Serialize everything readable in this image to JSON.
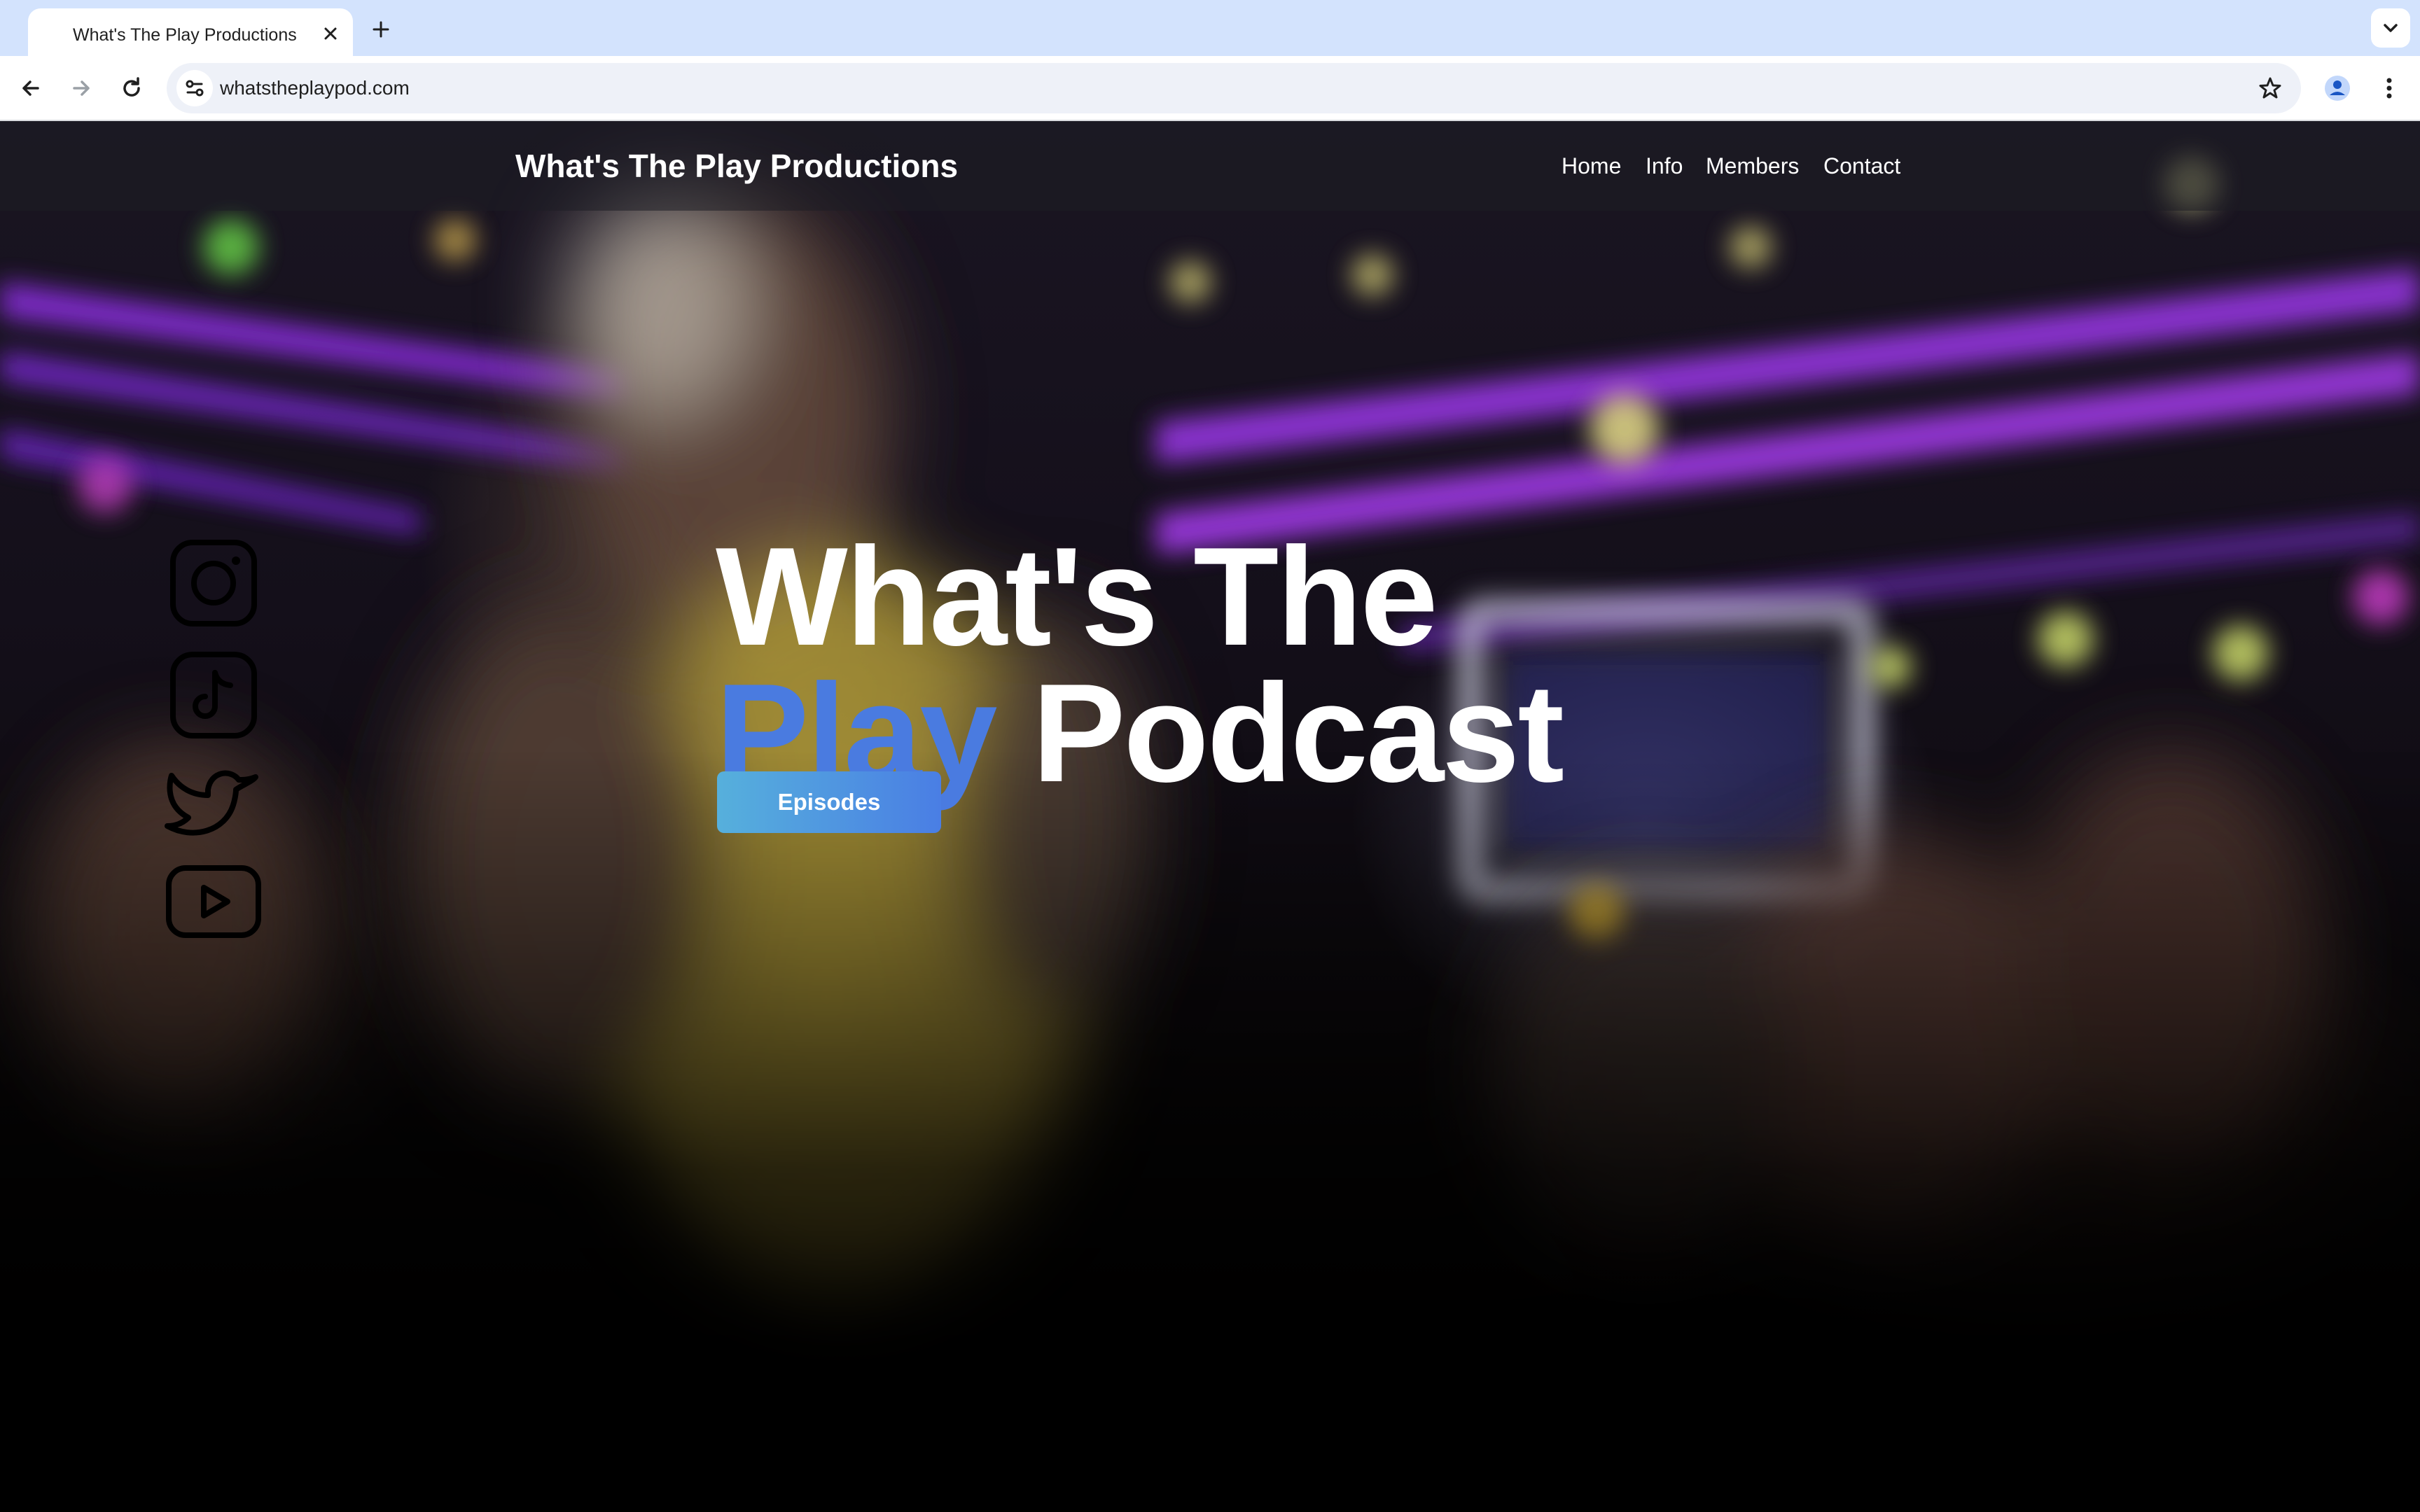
{
  "browser": {
    "tab": {
      "title": "What's The Play Productions"
    },
    "address_bar": {
      "url": "whatstheplaypod.com"
    },
    "icons": {
      "back": "arrow-left-icon",
      "forward": "arrow-right-icon",
      "reload": "reload-icon",
      "site_info": "tune-icon",
      "bookmark": "star-icon",
      "profile": "person-icon",
      "menu": "more-vertical-icon",
      "new_tab": "plus-icon",
      "close_tab": "close-icon",
      "tab_list": "chevron-down-icon"
    },
    "colors": {
      "tabstrip": "#d3e3fd",
      "toolbar": "#ffffff",
      "omnibox": "#eef1f8"
    }
  },
  "site": {
    "brand": "What's The Play Productions",
    "nav": [
      "Home",
      "Info",
      "Members",
      "Contact"
    ],
    "social": [
      "instagram-icon",
      "tiktok-icon",
      "twitter-icon",
      "youtube-icon"
    ],
    "hero": {
      "line1": "What's The",
      "line2_accent": "Play",
      "line2_rest": " Podcast"
    },
    "cta": {
      "label": "Episodes"
    },
    "colors": {
      "accent": "#4a7be0",
      "cta_gradient_start": "#56b0dc",
      "cta_gradient_end": "#4a7ee4",
      "text": "#ffffff"
    }
  }
}
